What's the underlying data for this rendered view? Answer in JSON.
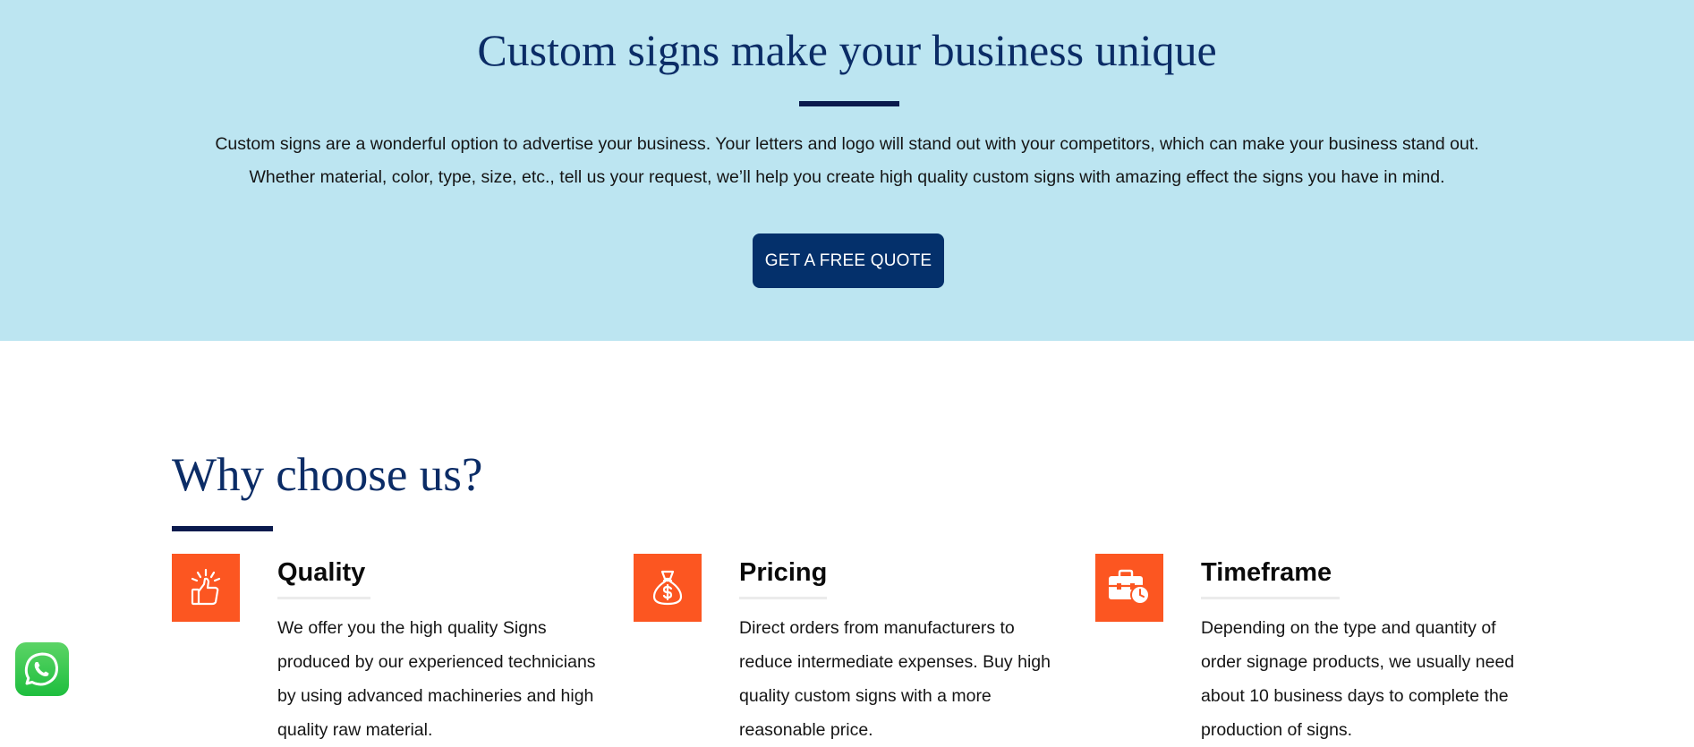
{
  "hero": {
    "title": "Custom signs make your business unique",
    "line1": "Custom signs are a wonderful option to advertise your business. Your letters and logo will stand out with your competitors, which can make your business stand out.",
    "line2": "Whether material, color, type, size, etc., tell us your request, we’ll help you create high quality custom signs with amazing effect the signs you have in mind.",
    "button_label": "GET A FREE QUOTE"
  },
  "why": {
    "title": "Why choose us?",
    "features": [
      {
        "title": "Quality",
        "icon": "thumbs-up-icon",
        "lines": [
          "We offer you the high quality Signs",
          "produced by our experienced technicians",
          "by using advanced machineries and high",
          "quality raw material."
        ]
      },
      {
        "title": "Pricing",
        "icon": "money-bag-icon",
        "lines": [
          "Direct orders from manufacturers to",
          "reduce intermediate expenses. Buy high",
          "quality custom signs with a more",
          "reasonable price."
        ]
      },
      {
        "title": "Timeframe",
        "icon": "briefcase-clock-icon",
        "lines": [
          "Depending on the type and quantity of",
          "order signage products, we usually need",
          "about 10 business days to complete the",
          "production of signs."
        ]
      }
    ]
  },
  "whatsapp": {
    "icon": "whatsapp-icon"
  },
  "colors": {
    "hero_bg": "#bce5f1",
    "heading": "#0b2c66",
    "button": "#04306b",
    "accent": "#fc5621"
  }
}
